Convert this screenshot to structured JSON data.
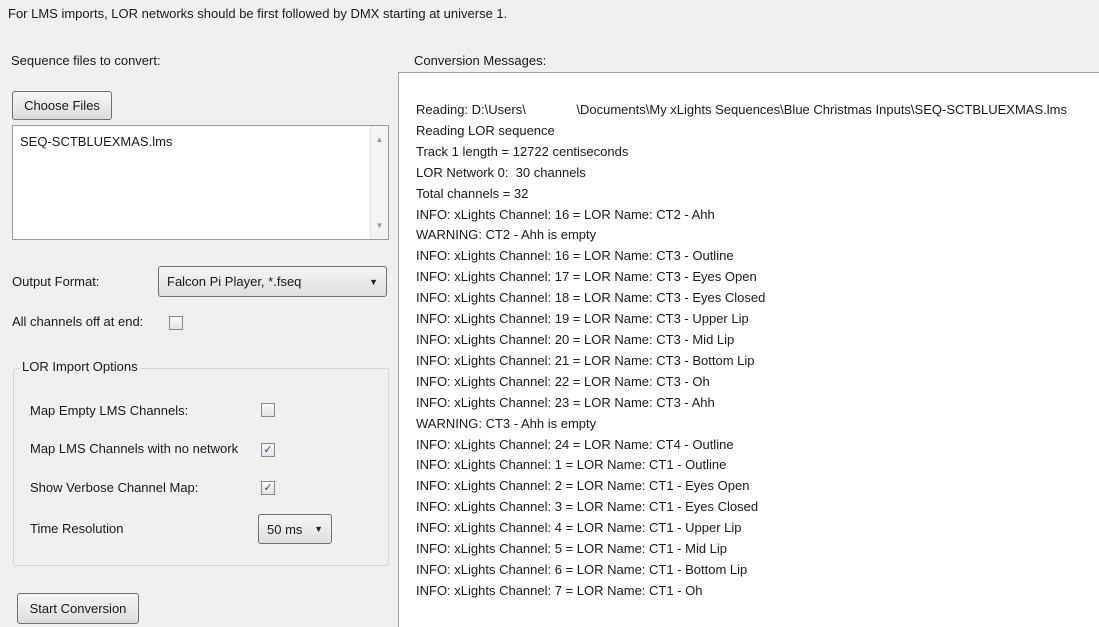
{
  "notice": "For LMS imports, LOR networks should be first followed by DMX starting at universe 1.",
  "left": {
    "files_label": "Sequence files to convert:",
    "choose_files": "Choose Files",
    "files": [
      "SEQ-SCTBLUEXMAS.lms"
    ],
    "output_format_label": "Output Format:",
    "output_format_value": "Falcon Pi Player, *.fseq",
    "all_off_label": "All channels off at end:",
    "all_off_checked": false,
    "lor_group_title": "LOR Import Options",
    "options": [
      {
        "label": "Map Empty LMS Channels:",
        "checked": false
      },
      {
        "label": "Map LMS Channels with no network",
        "checked": true
      },
      {
        "label": "Show Verbose Channel Map:",
        "checked": true
      }
    ],
    "time_resolution_label": "Time Resolution",
    "time_resolution_value": "50 ms",
    "start_button": "Start Conversion"
  },
  "right": {
    "messages_label": "Conversion Messages:",
    "messages": [
      "Reading: D:\\Users\\              \\Documents\\My xLights Sequences\\Blue Christmas Inputs\\SEQ-SCTBLUEXMAS.lms",
      "Reading LOR sequence",
      "Track 1 length = 12722 centiseconds",
      "LOR Network 0:  30 channels",
      "Total channels = 32",
      "INFO: xLights Channel: 16 = LOR Name: CT2 - Ahh",
      "WARNING: CT2 - Ahh is empty",
      "INFO: xLights Channel: 16 = LOR Name: CT3 - Outline",
      "INFO: xLights Channel: 17 = LOR Name: CT3 - Eyes Open",
      "INFO: xLights Channel: 18 = LOR Name: CT3 - Eyes Closed",
      "INFO: xLights Channel: 19 = LOR Name: CT3 - Upper Lip",
      "INFO: xLights Channel: 20 = LOR Name: CT3 - Mid Lip",
      "INFO: xLights Channel: 21 = LOR Name: CT3 - Bottom Lip",
      "INFO: xLights Channel: 22 = LOR Name: CT3 - Oh",
      "INFO: xLights Channel: 23 = LOR Name: CT3 - Ahh",
      "WARNING: CT3 - Ahh is empty",
      "INFO: xLights Channel: 24 = LOR Name: CT4 - Outline",
      "INFO: xLights Channel: 1 = LOR Name: CT1 - Outline",
      "INFO: xLights Channel: 2 = LOR Name: CT1 - Eyes Open",
      "INFO: xLights Channel: 3 = LOR Name: CT1 - Eyes Closed",
      "INFO: xLights Channel: 4 = LOR Name: CT1 - Upper Lip",
      "INFO: xLights Channel: 5 = LOR Name: CT1 - Mid Lip",
      "INFO: xLights Channel: 6 = LOR Name: CT1 - Bottom Lip",
      "INFO: xLights Channel: 7 = LOR Name: CT1 - Oh"
    ]
  }
}
